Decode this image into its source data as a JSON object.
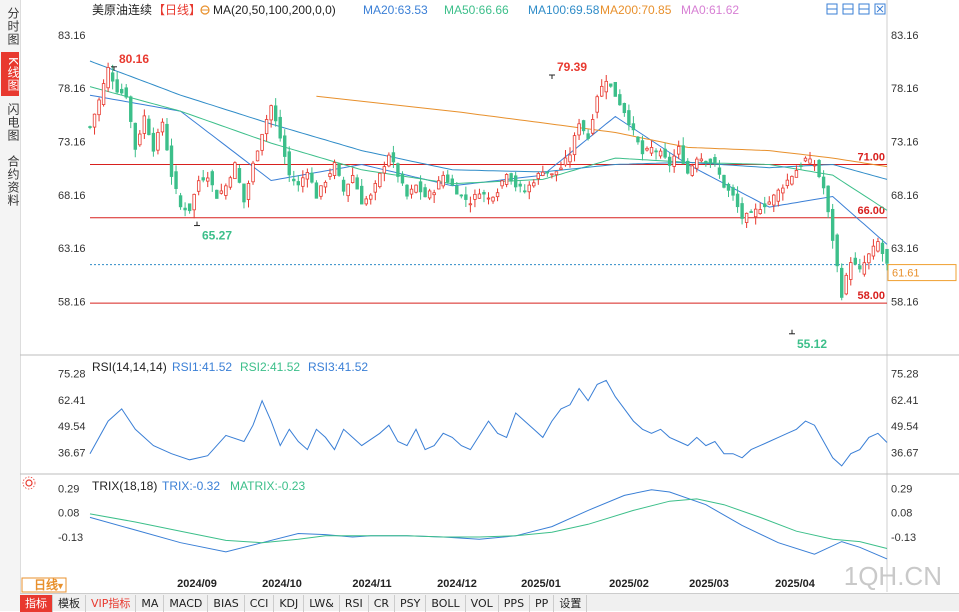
{
  "side_tabs": [
    {
      "label": "分时图",
      "active": false
    },
    {
      "label": "K线图",
      "active": true
    },
    {
      "label": "闪电图",
      "active": false
    },
    {
      "label": "合约资料",
      "active": false
    }
  ],
  "header": {
    "symbol": "美原油连续",
    "period": "【日线】",
    "ma_label": "MA(20,50,100,200,0,0)",
    "ma_items": [
      {
        "text": "MA20:63.53",
        "color": "#3a7fd6"
      },
      {
        "text": "MA50:66.66",
        "color": "#3cbf8a"
      },
      {
        "text": "MA100:69.58",
        "color": "#2f8cc8"
      },
      {
        "text": "MA200:70.85",
        "color": "#e8902c"
      },
      {
        "text": "MA0:61.62",
        "color": "#d77fd4"
      }
    ]
  },
  "rsi_header": {
    "label": "RSI(14,14,14)",
    "items": [
      {
        "text": "RSI1:41.52",
        "color": "#3a7fd6"
      },
      {
        "text": "RSI2:41.52",
        "color": "#3cbf8a"
      },
      {
        "text": "RSI3:41.52",
        "color": "#3a7fd6"
      }
    ]
  },
  "trix_header": {
    "label": "TRIX(18,18)",
    "items": [
      {
        "text": "TRIX:-0.32",
        "color": "#3a7fd6"
      },
      {
        "text": "MATRIX:-0.23",
        "color": "#3cbf8a"
      }
    ]
  },
  "period_button": "日线",
  "watermark": "1QH.CN",
  "indicator_tabs": [
    "指标",
    "模板",
    "VIP指标",
    "MA",
    "MACD",
    "BIAS",
    "CCI",
    "KDJ",
    "LW&",
    "RSI",
    "CR",
    "PSY",
    "BOLL",
    "VOL",
    "PPS",
    "PP",
    "设置"
  ],
  "colors": {
    "up": "#e8392f",
    "down": "#3cbf8a",
    "hline": "#d8201e",
    "current": "#2f8cc8"
  },
  "chart_data": [
    {
      "type": "candlestick",
      "title": "美原油连续 日线",
      "y_ticks": [
        83.16,
        78.16,
        73.16,
        68.16,
        63.16,
        58.16
      ],
      "ylim": [
        53.6,
        85.3
      ],
      "x_ticks": [
        "2024/09",
        "2024/10",
        "2024/11",
        "2024/12",
        "2025/01",
        "2025/02",
        "2025/03",
        "2025/04"
      ],
      "horizontal_lines": [
        {
          "value": 71.0,
          "label": "71.00"
        },
        {
          "value": 66.0,
          "label": "66.00"
        },
        {
          "value": 58.0,
          "label": "58.00"
        }
      ],
      "current_price": {
        "value": 61.61,
        "label": "61.61"
      },
      "annotations": [
        {
          "label": "80.16",
          "value": 80.16,
          "kind": "high"
        },
        {
          "label": "65.27",
          "value": 65.27,
          "kind": "low"
        },
        {
          "label": "79.39",
          "value": 79.39,
          "kind": "high"
        },
        {
          "label": "55.12",
          "value": 55.12,
          "kind": "low"
        }
      ],
      "close_path": [
        [
          0,
          74.5
        ],
        [
          4,
          77
        ],
        [
          8,
          80
        ],
        [
          12,
          78
        ],
        [
          16,
          77.5
        ],
        [
          20,
          72.5
        ],
        [
          24,
          75.5
        ],
        [
          28,
          72.5
        ],
        [
          32,
          75
        ],
        [
          36,
          70
        ],
        [
          40,
          67
        ],
        [
          44,
          66.8
        ],
        [
          48,
          69.5
        ],
        [
          52,
          70
        ],
        [
          56,
          68
        ],
        [
          60,
          69
        ],
        [
          64,
          71
        ],
        [
          68,
          67.5
        ],
        [
          72,
          71
        ],
        [
          76,
          74
        ],
        [
          80,
          76.5
        ],
        [
          84,
          73.5
        ],
        [
          88,
          70
        ],
        [
          92,
          69
        ],
        [
          96,
          70.5
        ],
        [
          100,
          68
        ],
        [
          104,
          69.5
        ],
        [
          108,
          71
        ],
        [
          112,
          68.5
        ],
        [
          116,
          70
        ],
        [
          120,
          67.5
        ],
        [
          124,
          68
        ],
        [
          128,
          70
        ],
        [
          132,
          72
        ],
        [
          136,
          70
        ],
        [
          140,
          68
        ],
        [
          144,
          69
        ],
        [
          148,
          68
        ],
        [
          152,
          68.6
        ],
        [
          156,
          70
        ],
        [
          160,
          69
        ],
        [
          164,
          68
        ],
        [
          168,
          67.5
        ],
        [
          172,
          68.5
        ],
        [
          176,
          67.8
        ],
        [
          180,
          68.6
        ],
        [
          184,
          70.3
        ],
        [
          188,
          69
        ],
        [
          192,
          68.5
        ],
        [
          196,
          69.5
        ],
        [
          200,
          70.5
        ],
        [
          204,
          70
        ],
        [
          208,
          70.7
        ],
        [
          212,
          72
        ],
        [
          216,
          75
        ],
        [
          220,
          73.5
        ],
        [
          224,
          77.5
        ],
        [
          228,
          79
        ],
        [
          232,
          77.5
        ],
        [
          236,
          76
        ],
        [
          240,
          74
        ],
        [
          244,
          72
        ],
        [
          248,
          72.5
        ],
        [
          252,
          72
        ],
        [
          256,
          71
        ],
        [
          260,
          72.5
        ],
        [
          264,
          70.2
        ],
        [
          268,
          71.7
        ],
        [
          272,
          71.5
        ],
        [
          276,
          71
        ],
        [
          280,
          69
        ],
        [
          284,
          68
        ],
        [
          288,
          66
        ],
        [
          292,
          66.3
        ],
        [
          296,
          67
        ],
        [
          300,
          67.5
        ],
        [
          304,
          68.5
        ],
        [
          308,
          69.5
        ],
        [
          312,
          70.5
        ],
        [
          316,
          71.5
        ],
        [
          320,
          71
        ],
        [
          324,
          68.8
        ],
        [
          328,
          64
        ],
        [
          332,
          58.8
        ],
        [
          336,
          62
        ],
        [
          340,
          61
        ],
        [
          344,
          62.5
        ],
        [
          348,
          63.7
        ],
        [
          352,
          61.6
        ]
      ],
      "series": [
        {
          "name": "MA20",
          "color": "#3a7fd6",
          "values": [
            [
              0,
              77.5
            ],
            [
              40,
              76
            ],
            [
              80,
              69.5
            ],
            [
              120,
              71
            ],
            [
              160,
              69
            ],
            [
              200,
              70
            ],
            [
              232,
              75.5
            ],
            [
              264,
              71
            ],
            [
              300,
              67
            ],
            [
              328,
              68
            ],
            [
              352,
              63.5
            ]
          ]
        },
        {
          "name": "MA50",
          "color": "#3cbf8a",
          "values": [
            [
              0,
              78.3
            ],
            [
              40,
              76
            ],
            [
              80,
              73
            ],
            [
              120,
              70.5
            ],
            [
              160,
              69.2
            ],
            [
              200,
              69.6
            ],
            [
              232,
              71.6
            ],
            [
              264,
              71.2
            ],
            [
              300,
              71
            ],
            [
              328,
              70
            ],
            [
              352,
              66.7
            ]
          ]
        },
        {
          "name": "MA100",
          "color": "#2f8cc8",
          "values": [
            [
              0,
              80.7
            ],
            [
              40,
              77.5
            ],
            [
              80,
              74.8
            ],
            [
              120,
              72.3
            ],
            [
              160,
              70.5
            ],
            [
              200,
              70.3
            ],
            [
              232,
              71
            ],
            [
              264,
              71.2
            ],
            [
              300,
              70.7
            ],
            [
              328,
              71
            ],
            [
              352,
              69.6
            ]
          ]
        },
        {
          "name": "MA200",
          "color": "#e8902c",
          "values": [
            [
              100,
              77.4
            ],
            [
              160,
              76
            ],
            [
              200,
              74.9
            ],
            [
              232,
              74
            ],
            [
              264,
              72.6
            ],
            [
              300,
              72.3
            ],
            [
              328,
              71.6
            ],
            [
              352,
              70.8
            ]
          ]
        }
      ]
    },
    {
      "type": "line",
      "title": "RSI(14,14,14)",
      "y_ticks": [
        75.28,
        62.41,
        49.54,
        36.67
      ],
      "ylim": [
        28,
        82
      ],
      "x_ticks": [
        "2024/09",
        "2024/10",
        "2024/11",
        "2024/12",
        "2025/01",
        "2025/02",
        "2025/03",
        "2025/04"
      ],
      "series": [
        {
          "name": "RSI",
          "color": "#3a7fd6",
          "values": [
            [
              0,
              36
            ],
            [
              8,
              52
            ],
            [
              14,
              58
            ],
            [
              20,
              48
            ],
            [
              28,
              40
            ],
            [
              36,
              36
            ],
            [
              44,
              33
            ],
            [
              52,
              35
            ],
            [
              60,
              45
            ],
            [
              68,
              42
            ],
            [
              72,
              50
            ],
            [
              76,
              62
            ],
            [
              80,
              52
            ],
            [
              84,
              40
            ],
            [
              88,
              48
            ],
            [
              92,
              42
            ],
            [
              96,
              38
            ],
            [
              100,
              48
            ],
            [
              104,
              44
            ],
            [
              108,
              38
            ],
            [
              112,
              48
            ],
            [
              116,
              44
            ],
            [
              120,
              40
            ],
            [
              128,
              46
            ],
            [
              132,
              50
            ],
            [
              136,
              42
            ],
            [
              140,
              40
            ],
            [
              144,
              48
            ],
            [
              148,
              38
            ],
            [
              152,
              40
            ],
            [
              156,
              46
            ],
            [
              160,
              44
            ],
            [
              164,
              40
            ],
            [
              168,
              38
            ],
            [
              176,
              52
            ],
            [
              180,
              46
            ],
            [
              184,
              44
            ],
            [
              188,
              56
            ],
            [
              192,
              52
            ],
            [
              196,
              48
            ],
            [
              200,
              44
            ],
            [
              204,
              52
            ],
            [
              208,
              58
            ],
            [
              212,
              60
            ],
            [
              216,
              68
            ],
            [
              220,
              62
            ],
            [
              224,
              70
            ],
            [
              228,
              72
            ],
            [
              232,
              64
            ],
            [
              236,
              58
            ],
            [
              240,
              52
            ],
            [
              244,
              48
            ],
            [
              248,
              46
            ],
            [
              252,
              48
            ],
            [
              256,
              44
            ],
            [
              260,
              42
            ],
            [
              264,
              40
            ],
            [
              268,
              44
            ],
            [
              272,
              40
            ],
            [
              276,
              42
            ],
            [
              280,
              36
            ],
            [
              284,
              36
            ],
            [
              288,
              34
            ],
            [
              292,
              38
            ],
            [
              296,
              40
            ],
            [
              300,
              42
            ],
            [
              304,
              44
            ],
            [
              308,
              46
            ],
            [
              312,
              48
            ],
            [
              316,
              52
            ],
            [
              320,
              50
            ],
            [
              324,
              42
            ],
            [
              328,
              34
            ],
            [
              332,
              30
            ],
            [
              336,
              36
            ],
            [
              340,
              38
            ],
            [
              344,
              44
            ],
            [
              348,
              46
            ],
            [
              352,
              41.5
            ]
          ]
        }
      ]
    },
    {
      "type": "line",
      "title": "TRIX(18,18)",
      "y_ticks": [
        0.29,
        0.08,
        -0.13
      ],
      "ylim": [
        -0.46,
        0.39
      ],
      "x_ticks": [
        "2024/09",
        "2024/10",
        "2024/11",
        "2024/12",
        "2025/01",
        "2025/02",
        "2025/03",
        "2025/04"
      ],
      "series": [
        {
          "name": "TRIX",
          "color": "#3a7fd6",
          "values": [
            [
              0,
              0.04
            ],
            [
              20,
              -0.07
            ],
            [
              40,
              -0.18
            ],
            [
              60,
              -0.26
            ],
            [
              76,
              -0.18
            ],
            [
              92,
              -0.1
            ],
            [
              104,
              -0.11
            ],
            [
              116,
              -0.13
            ],
            [
              124,
              -0.12
            ],
            [
              140,
              -0.12
            ],
            [
              156,
              -0.13
            ],
            [
              172,
              -0.15
            ],
            [
              188,
              -0.12
            ],
            [
              204,
              -0.04
            ],
            [
              220,
              0.1
            ],
            [
              236,
              0.23
            ],
            [
              248,
              0.28
            ],
            [
              256,
              0.26
            ],
            [
              272,
              0.15
            ],
            [
              288,
              -0.03
            ],
            [
              304,
              -0.18
            ],
            [
              320,
              -0.28
            ],
            [
              332,
              -0.17
            ],
            [
              340,
              -0.22
            ],
            [
              352,
              -0.32
            ]
          ]
        },
        {
          "name": "MATRIX",
          "color": "#3cbf8a",
          "values": [
            [
              0,
              0.07
            ],
            [
              20,
              0.0
            ],
            [
              40,
              -0.08
            ],
            [
              60,
              -0.16
            ],
            [
              76,
              -0.18
            ],
            [
              92,
              -0.15
            ],
            [
              104,
              -0.12
            ],
            [
              124,
              -0.12
            ],
            [
              140,
              -0.12
            ],
            [
              156,
              -0.13
            ],
            [
              172,
              -0.13
            ],
            [
              188,
              -0.12
            ],
            [
              204,
              -0.09
            ],
            [
              220,
              -0.02
            ],
            [
              240,
              0.1
            ],
            [
              256,
              0.18
            ],
            [
              268,
              0.2
            ],
            [
              280,
              0.15
            ],
            [
              296,
              0.04
            ],
            [
              312,
              -0.08
            ],
            [
              328,
              -0.15
            ],
            [
              340,
              -0.17
            ],
            [
              352,
              -0.23
            ]
          ]
        }
      ]
    }
  ]
}
